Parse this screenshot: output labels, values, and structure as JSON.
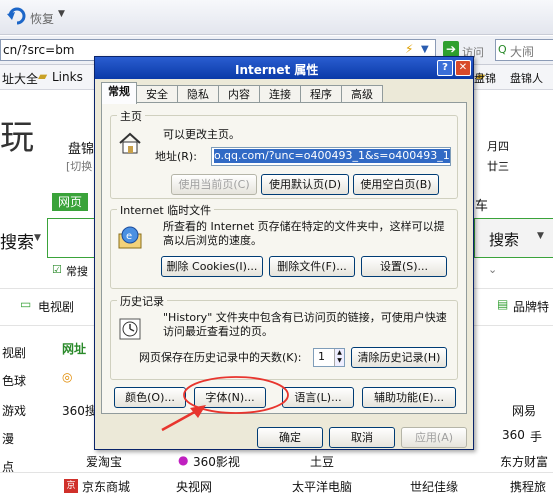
{
  "browser": {
    "back_label": "恢复",
    "url_text": "cn/?src=bm",
    "go_label": "访问",
    "search_placeholder": "大闹",
    "favorites": [
      "址大全",
      "Links"
    ],
    "right_links": [
      "盘锦",
      "盘锦人"
    ]
  },
  "page": {
    "left_big_char": "玩",
    "panjin": "盘锦",
    "switch": "[切换",
    "date": "月四",
    "lunar": "廿三",
    "webpage_tab": "网页",
    "car": "车",
    "search_left": "搜索",
    "search_button": "搜索",
    "common": "常搜",
    "tv": "电视剧",
    "brand": "品牌特",
    "nav_left": [
      "视剧",
      "色球",
      "游戏",
      "漫",
      "点"
    ],
    "site_title": "网址",
    "row_360": "360搜",
    "row_wangyi": "网易",
    "row_360_2": "360",
    "hand": "手",
    "bottom_links": [
      "爱淘宝",
      "360影视",
      "土豆",
      "",
      "东方财富"
    ],
    "footer_links": [
      "京东商城",
      "央视网",
      "太平洋电脑",
      "世纪佳缘",
      "携程旅"
    ]
  },
  "dialog": {
    "title": "Internet 属性",
    "tabs": [
      "常规",
      "安全",
      "隐私",
      "内容",
      "连接",
      "程序",
      "高级"
    ],
    "home": {
      "group_title": "主页",
      "desc": "可以更改主页。",
      "address_label": "地址(R):",
      "address_value": "o.qq.com/?unc=o400493_1&s=o400493_1",
      "use_current": "使用当前页(C)",
      "use_default": "使用默认页(D)",
      "use_blank": "使用空白页(B)"
    },
    "temp": {
      "group_title": "Internet 临时文件",
      "desc": "所查看的 Internet 页存储在特定的文件夹中，这样可以提高以后浏览的速度。",
      "delete_cookies": "删除 Cookies(I)...",
      "delete_files": "删除文件(F)...",
      "settings": "设置(S)..."
    },
    "history": {
      "group_title": "历史记录",
      "desc": "\"History\" 文件夹中包含有已访问页的链接，可使用户快速访问最近查看过的页。",
      "days_label": "网页保存在历史记录中的天数(K):",
      "days_value": "1",
      "clear": "清除历史记录(H)"
    },
    "bottom_buttons": {
      "colors": "颜色(O)...",
      "fonts": "字体(N)...",
      "languages": "语言(L)...",
      "accessibility": "辅助功能(E)..."
    },
    "ok": "确定",
    "cancel": "取消",
    "apply": "应用(A)"
  },
  "colors": {
    "title_bar": "#0a3aa8",
    "dialog_bg": "#ece9d8",
    "annotation_red": "#e8352e",
    "green_button": "#3aa33a"
  }
}
